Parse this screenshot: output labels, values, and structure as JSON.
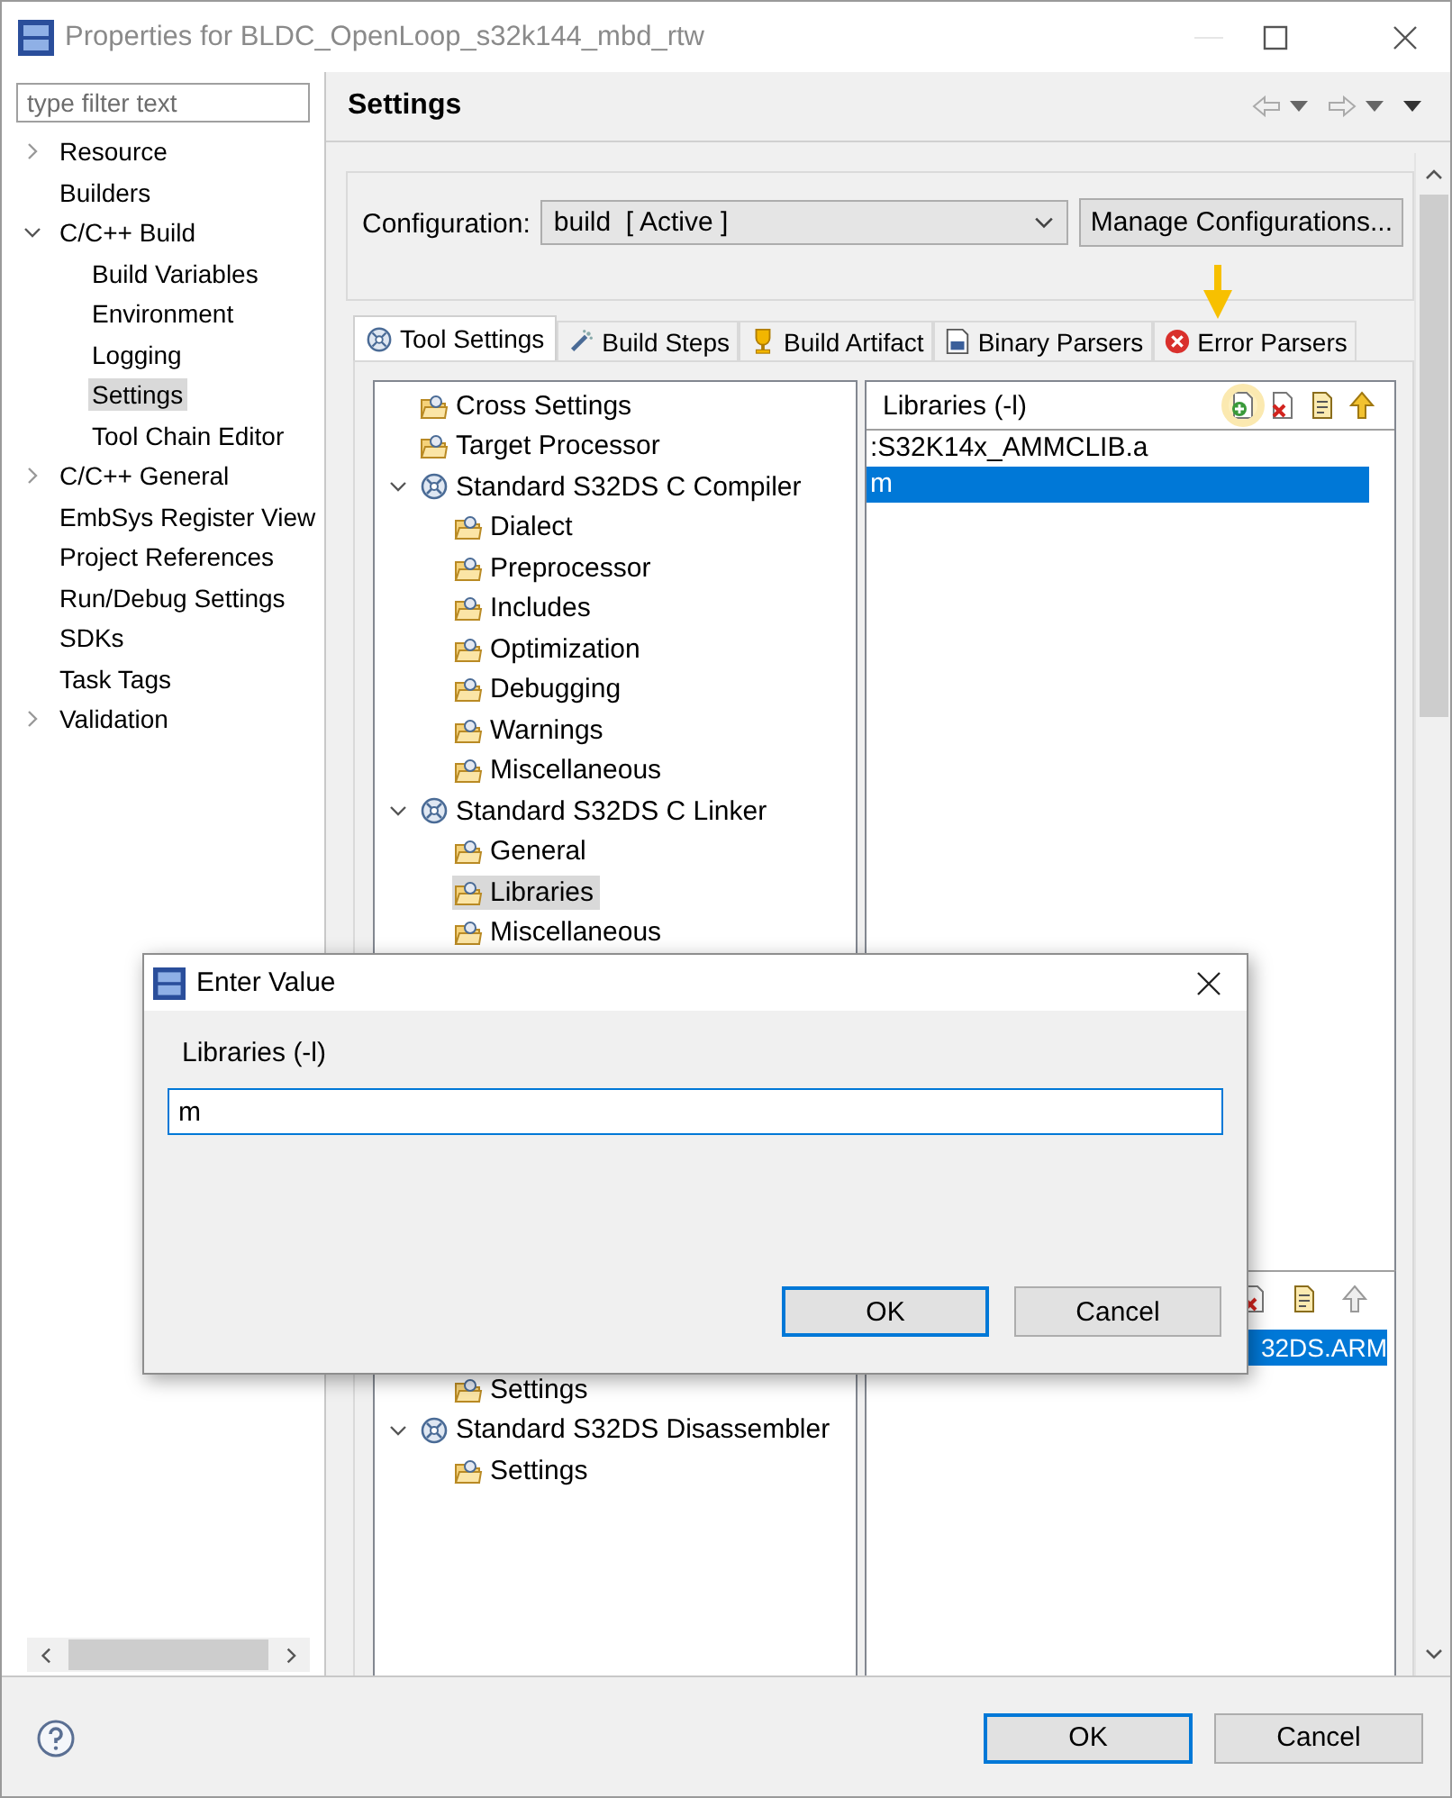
{
  "window": {
    "title": "Properties for BLDC_OpenLoop_s32k144_mbd_rtw"
  },
  "sidebar": {
    "filter": {
      "placeholder": "type filter text"
    },
    "items": [
      {
        "label": "Resource",
        "expanded": false,
        "selected": false
      },
      {
        "label": "Builders",
        "selected": false
      },
      {
        "label": "C/C++ Build",
        "expanded": true,
        "selected": false,
        "children": [
          {
            "label": "Build Variables",
            "selected": false
          },
          {
            "label": "Environment",
            "selected": false
          },
          {
            "label": "Logging",
            "selected": false
          },
          {
            "label": "Settings",
            "selected": true
          },
          {
            "label": "Tool Chain Editor",
            "selected": false
          }
        ]
      },
      {
        "label": "C/C++ General",
        "expanded": false,
        "selected": false
      },
      {
        "label": "EmbSys Register View",
        "selected": false
      },
      {
        "label": "Project References",
        "selected": false
      },
      {
        "label": "Run/Debug Settings",
        "selected": false
      },
      {
        "label": "SDKs",
        "selected": false
      },
      {
        "label": "Task Tags",
        "selected": false
      },
      {
        "label": "Validation",
        "expanded": false,
        "selected": false
      }
    ]
  },
  "page": {
    "title": "Settings"
  },
  "configuration": {
    "label": "Configuration:",
    "value": "build  [ Active ]",
    "button": "Manage Configurations..."
  },
  "tabs": [
    {
      "label": "Tool Settings",
      "selected": true
    },
    {
      "label": "Build Steps",
      "selected": false
    },
    {
      "label": "Build Artifact",
      "selected": false
    },
    {
      "label": "Binary Parsers",
      "selected": false
    },
    {
      "label": "Error Parsers",
      "selected": false
    }
  ],
  "tool_tree": {
    "items": [
      {
        "kind": "category",
        "label": "Cross Settings",
        "selected": false
      },
      {
        "kind": "category",
        "label": "Target Processor",
        "selected": false
      },
      {
        "kind": "tool",
        "label": "Standard S32DS C Compiler",
        "expanded": true,
        "selected": false,
        "children": [
          {
            "kind": "category",
            "label": "Dialect",
            "selected": false
          },
          {
            "kind": "category",
            "label": "Preprocessor",
            "selected": false
          },
          {
            "kind": "category",
            "label": "Includes",
            "selected": false
          },
          {
            "kind": "category",
            "label": "Optimization",
            "selected": false
          },
          {
            "kind": "category",
            "label": "Debugging",
            "selected": false
          },
          {
            "kind": "category",
            "label": "Warnings",
            "selected": false
          },
          {
            "kind": "category",
            "label": "Miscellaneous",
            "selected": false
          }
        ]
      },
      {
        "kind": "tool",
        "label": "Standard S32DS C Linker",
        "expanded": true,
        "selected": false,
        "children": [
          {
            "kind": "category",
            "label": "General",
            "selected": false
          },
          {
            "kind": "category",
            "label": "Libraries",
            "selected": true
          },
          {
            "kind": "category",
            "label": "Miscellaneous",
            "selected": false
          }
        ]
      }
    ],
    "children_continued": [
      {
        "kind": "category",
        "label": "Settings",
        "selected": false
      }
    ],
    "items_below": [
      {
        "kind": "tool",
        "label": "Standard S32DS Disassembler",
        "expanded": true,
        "selected": false,
        "children": [
          {
            "kind": "category",
            "label": "Settings",
            "selected": false
          }
        ]
      }
    ]
  },
  "libraries": {
    "title": "Libraries (-l)",
    "items": [
      {
        "value": ":S32K14x_AMMCLIB.a",
        "selected": false
      },
      {
        "value": "m",
        "selected": true
      }
    ]
  },
  "lower_list": {
    "items": [
      {
        "value": "32DS.ARM",
        "selected": true
      }
    ]
  },
  "dialog": {
    "title": "Enter Value",
    "label": "Libraries (-l)",
    "value": "m",
    "buttons": [
      {
        "label": "OK",
        "default": true
      },
      {
        "label": "Cancel",
        "default": false
      }
    ]
  },
  "buttons": [
    {
      "label": "OK",
      "default": true
    },
    {
      "label": "Cancel",
      "default": false
    }
  ]
}
